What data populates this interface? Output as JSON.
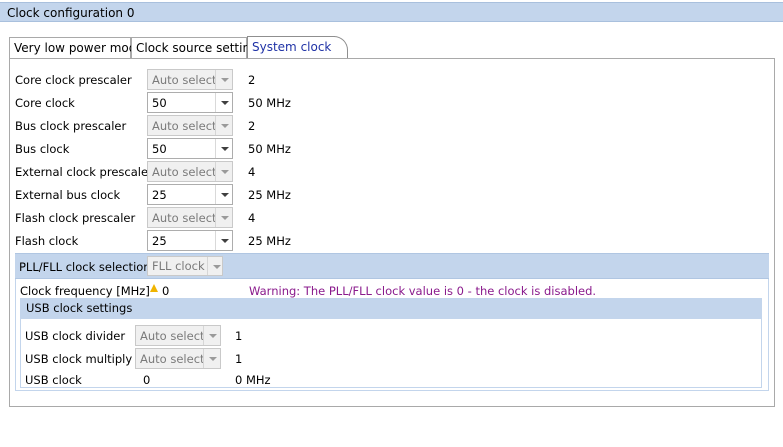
{
  "window": {
    "title": "Clock configuration 0"
  },
  "tabs": [
    {
      "label": "Very low power mode",
      "active": false
    },
    {
      "label": "Clock source setting",
      "active": false
    },
    {
      "label": "System clocks",
      "active": true
    }
  ],
  "rows": [
    {
      "label": "Core clock prescaler",
      "value": "Auto select",
      "output": "2"
    },
    {
      "label": "Core clock",
      "value": "50",
      "output": "50 MHz"
    },
    {
      "label": "Bus clock prescaler",
      "value": "Auto select",
      "output": "2"
    },
    {
      "label": "Bus clock",
      "value": "50",
      "output": "50 MHz"
    },
    {
      "label": "External clock prescaler",
      "value": "Auto select",
      "output": "4"
    },
    {
      "label": "External bus clock",
      "value": "25",
      "output": "25 MHz"
    },
    {
      "label": "Flash clock prescaler",
      "value": "Auto select",
      "output": "4"
    },
    {
      "label": "Flash clock",
      "value": "25",
      "output": "25 MHz"
    }
  ],
  "pll": {
    "label": "PLL/FLL clock selection",
    "value": "FLL clock",
    "freq_label": "Clock frequency [MHz]",
    "freq_value": "0",
    "warning": "Warning: The PLL/FLL clock value is 0 - the clock is disabled."
  },
  "usb": {
    "header": "USB clock settings",
    "divider_label": "USB clock divider",
    "divider_value": "Auto select",
    "divider_output": "1",
    "multiply_label": "USB clock multiply",
    "multiply_value": "Auto select",
    "multiply_output": "1",
    "clock_label": "USB clock",
    "clock_value": "0",
    "clock_output": "0 MHz"
  },
  "colors": {
    "header_bg": "#c3d5ec",
    "warning": "#8a1a8c",
    "active_tab": "#1f32a6",
    "warn_icon": "#f0b400"
  },
  "icons": [
    "chevron-down-icon",
    "warning-icon"
  ]
}
